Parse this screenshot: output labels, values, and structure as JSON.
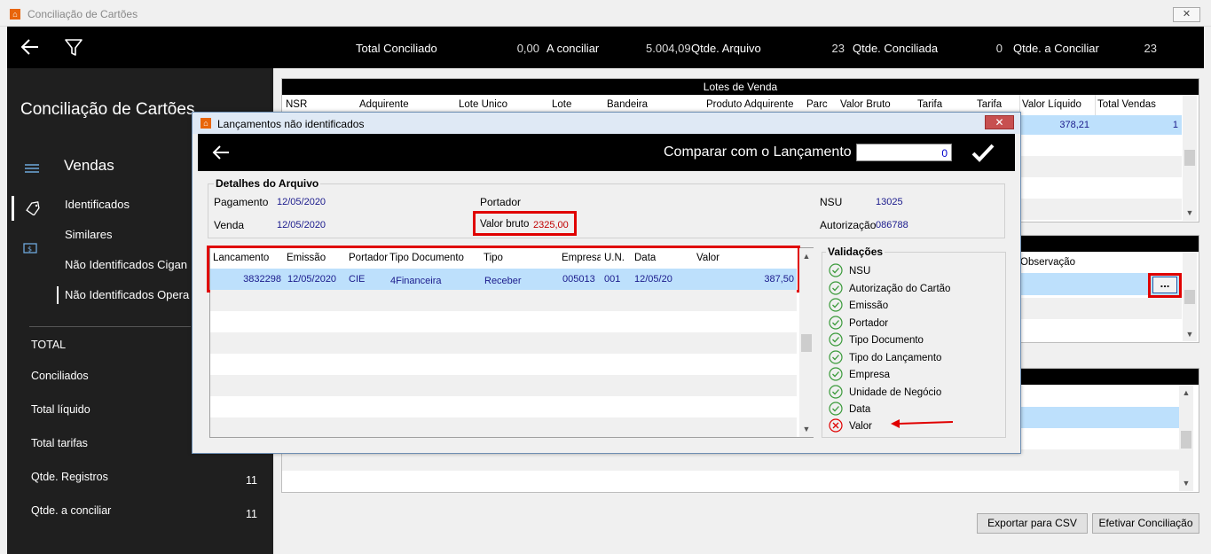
{
  "window": {
    "title": "Conciliação de Cartões",
    "close_label": "✕"
  },
  "topbar": {
    "total_conciliado_label": "Total Conciliado",
    "total_conciliado_value": "0,00",
    "a_conciliar_label": "A conciliar",
    "a_conciliar_value": "5.004,09",
    "qtde_arquivo_label": "Qtde. Arquivo",
    "qtde_arquivo_value": "23",
    "qtde_conciliada_label": "Qtde. Conciliada",
    "qtde_conciliada_value": "0",
    "qtde_a_conciliar_label": "Qtde. a Conciliar",
    "qtde_a_conciliar_value": "23"
  },
  "sidebar": {
    "title": "Conciliação de Cartões",
    "section": "Vendas",
    "items": [
      {
        "label": "Identificados"
      },
      {
        "label": "Similares"
      },
      {
        "label": "Não Identificados Cigan"
      },
      {
        "label": "Não Identificados Opera"
      }
    ],
    "totals": [
      {
        "label": "TOTAL",
        "value": ""
      },
      {
        "label": "Conciliados",
        "value": ""
      },
      {
        "label": "Total líquido",
        "value": ""
      },
      {
        "label": "Total tarifas",
        "value": ""
      },
      {
        "label": "Qtde. Registros",
        "value": "11"
      },
      {
        "label": "Qtde. a conciliar",
        "value": "11"
      }
    ]
  },
  "lotes": {
    "title": "Lotes de Venda",
    "columns": [
      "NSR",
      "Adquirente",
      "Lote Único",
      "Lote",
      "Bandeira",
      "Produto Adquirente",
      "Parc",
      "Valor Bruto",
      "Tarifa",
      "Tarifa",
      "Valor Líquido",
      "Total Vendas"
    ],
    "row": {
      "valor_liquido": "378,21",
      "total_vendas": "1"
    }
  },
  "middle_grid": {
    "observacao_header": "Observação",
    "ellipsis_label": "..."
  },
  "buttons": {
    "exportar": "Exportar para CSV",
    "efetivar": "Efetivar Conciliação"
  },
  "dialog": {
    "title": "Lançamentos não identificados",
    "compare_label": "Comparar com o Lançamento",
    "compare_value": "0",
    "detalhes": {
      "legend": "Detalhes do Arquivo",
      "pagamento_label": "Pagamento",
      "pagamento_value": "12/05/2020",
      "venda_label": "Venda",
      "venda_value": "12/05/2020",
      "portador_label": "Portador",
      "portador_value": "",
      "valor_bruto_label": "Valor bruto",
      "valor_bruto_value": "2325,00",
      "nsu_label": "NSU",
      "nsu_value": "13025",
      "autorizacao_label": "Autorização",
      "autorizacao_value": "086788"
    },
    "grid": {
      "columns": [
        "Lancamento",
        "Emissão",
        "Portador",
        "Tipo Documento",
        "Tipo",
        "Empresa",
        "U.N.",
        "Data",
        "Valor"
      ],
      "row": {
        "lancamento": "3832298",
        "emissao": "12/05/2020",
        "portador": "CIE",
        "tipo_documento": "4Financeira",
        "tipo": "Receber",
        "empresa": "005013",
        "un": "001",
        "data": "12/05/20",
        "valor": "387,50"
      }
    },
    "validacoes": {
      "legend": "Validações",
      "items": [
        {
          "label": "NSU",
          "status": "ok"
        },
        {
          "label": "Autorização do Cartão",
          "status": "ok"
        },
        {
          "label": "Emissão",
          "status": "ok"
        },
        {
          "label": "Portador",
          "status": "ok"
        },
        {
          "label": "Tipo Documento",
          "status": "ok"
        },
        {
          "label": "Tipo do Lançamento",
          "status": "ok"
        },
        {
          "label": "Empresa",
          "status": "ok"
        },
        {
          "label": "Unidade de Negócio",
          "status": "ok"
        },
        {
          "label": "Data",
          "status": "ok"
        },
        {
          "label": "Valor",
          "status": "error"
        }
      ]
    }
  },
  "colors": {
    "accent_orange": "#e8650a",
    "selection_blue": "#bde0fc",
    "highlight_red": "#e00000",
    "ok_green": "#3a9a3a",
    "value_blue": "#1a1a8c"
  }
}
